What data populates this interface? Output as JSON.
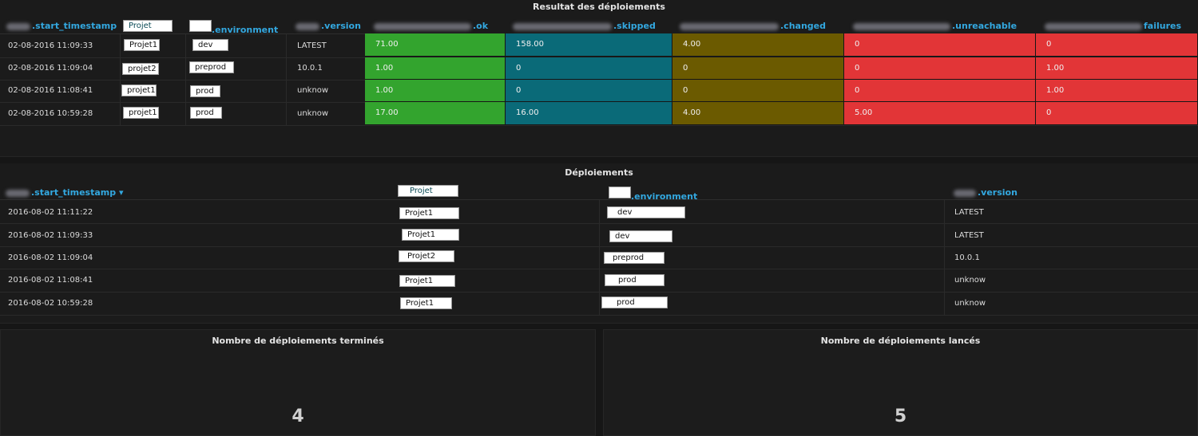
{
  "panel1": {
    "title": "Resultat des déploiements",
    "headers": {
      "start_timestamp": ".start_timestamp",
      "projet": "Projet",
      "environment": ".environment",
      "version": ".version",
      "ok": ".ok",
      "skipped": ".skipped",
      "changed": ".changed",
      "unreachable": ".unreachable",
      "failures": "failures"
    },
    "rows": [
      {
        "ts": "02-08-2016 11:09:33",
        "projet": "Projet1",
        "env": "dev",
        "version": "LATEST",
        "ok": "71.00",
        "skipped": "158.00",
        "changed": "4.00",
        "unreachable": "0",
        "failures": "0"
      },
      {
        "ts": "02-08-2016 11:09:04",
        "projet": "projet2",
        "env": "preprod",
        "version": "10.0.1",
        "ok": "1.00",
        "skipped": "0",
        "changed": "0",
        "unreachable": "0",
        "failures": "1.00"
      },
      {
        "ts": "02-08-2016 11:08:41",
        "projet": "projet1",
        "env": "prod",
        "version": "unknow",
        "ok": "1.00",
        "skipped": "0",
        "changed": "0",
        "unreachable": "0",
        "failures": "1.00"
      },
      {
        "ts": "02-08-2016 10:59:28",
        "projet": "projet1",
        "env": "prod",
        "version": "unknow",
        "ok": "17.00",
        "skipped": "16.00",
        "changed": "4.00",
        "unreachable": "5.00",
        "failures": "0"
      }
    ]
  },
  "panel2": {
    "title": "Déploiements",
    "headers": {
      "start_timestamp": ".start_timestamp",
      "sort_arrow": "▾",
      "projet": "Projet",
      "environment": ".environment",
      "version": ".version"
    },
    "rows": [
      {
        "ts": "2016-08-02 11:11:22",
        "projet": "Projet1",
        "env": "dev",
        "version": "LATEST"
      },
      {
        "ts": "2016-08-02 11:09:33",
        "projet": "Projet1",
        "env": "dev",
        "version": "LATEST"
      },
      {
        "ts": "2016-08-02 11:09:04",
        "projet": "Projet2",
        "env": "preprod",
        "version": "10.0.1"
      },
      {
        "ts": "2016-08-02 11:08:41",
        "projet": "Projet1",
        "env": "prod",
        "version": "unknow"
      },
      {
        "ts": "2016-08-02 10:59:28",
        "projet": "Projet1",
        "env": "prod",
        "version": "unknow"
      }
    ]
  },
  "stats": {
    "finished": {
      "title": "Nombre de déploiements terminés",
      "value": "4"
    },
    "launched": {
      "title": "Nombre de déploiements lancés",
      "value": "5"
    }
  },
  "colors": {
    "header_link": "#33a8e0",
    "ok": "#33a42e",
    "skipped": "#0a6a78",
    "changed": "#6b5a00",
    "error": "#e23537"
  }
}
